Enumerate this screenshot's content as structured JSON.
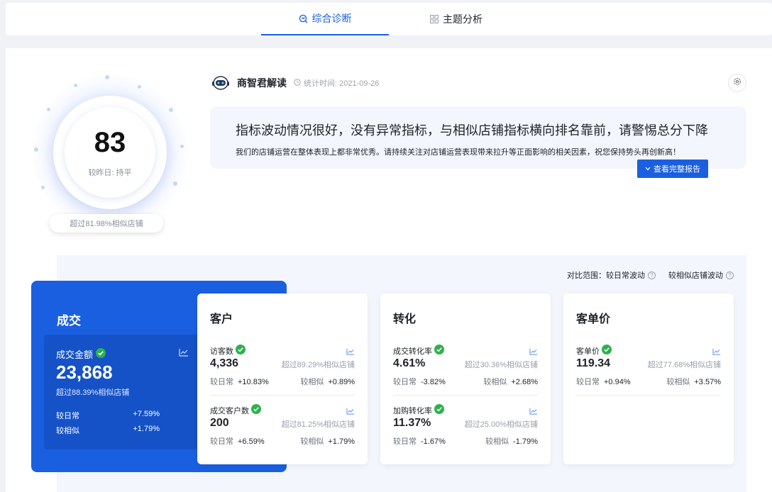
{
  "tabs": [
    {
      "label": "综合诊断",
      "active": true
    },
    {
      "label": "主题分析",
      "active": false
    }
  ],
  "score": {
    "value": "83",
    "compare": "较昨日: 持平",
    "exceed": "超过81.98%相似店铺",
    "value_number": 83
  },
  "insight": {
    "source": "商智君解读",
    "time": "统计时间: 2021-09-26",
    "headline": "指标波动情况很好，没有异常指标，与相似店铺指标横向排名靠前，请警惕总分下降",
    "detail": "我们的店铺运营在整体表现上都非常优秀。请持续关注对店铺运营表现带来拉升等正面影响的相关因素，祝您保持势头再创新高！",
    "report_button": "查看完整报告"
  },
  "compare_range": {
    "label1": "对比范围：较日常波动",
    "label2": "较相似店铺波动"
  },
  "deal": {
    "title": "成交",
    "metric_name": "成交金额",
    "value": "23,868",
    "exceed": "超过88.39%相似店铺",
    "rows": [
      {
        "label": "较日常",
        "value": "+7.59%"
      },
      {
        "label": "较相似",
        "value": "+1.79%"
      }
    ]
  },
  "cards": [
    {
      "title": "客户",
      "metrics": [
        {
          "name": "访客数",
          "value": "4,336",
          "exceed": "超过89.29%相似店铺",
          "daily_label": "较日常",
          "daily": "+10.83%",
          "similar_label": "较相似",
          "similar": "+0.89%"
        },
        {
          "name": "成交客户数",
          "value": "200",
          "exceed": "超过81.25%相似店铺",
          "daily_label": "较日常",
          "daily": "+6.59%",
          "similar_label": "较相似",
          "similar": "+1.79%"
        }
      ]
    },
    {
      "title": "转化",
      "metrics": [
        {
          "name": "成交转化率",
          "value": "4.61%",
          "exceed": "超过30.36%相似店铺",
          "daily_label": "较日常",
          "daily": "-3.82%",
          "similar_label": "较相似",
          "similar": "+2.68%"
        },
        {
          "name": "加购转化率",
          "value": "11.37%",
          "exceed": "超过25.00%相似店铺",
          "daily_label": "较日常",
          "daily": "-1.67%",
          "similar_label": "较相似",
          "similar": "-1.79%"
        }
      ]
    },
    {
      "title": "客单价",
      "metrics": [
        {
          "name": "客单价",
          "value": "119.34",
          "exceed": "超过77.68%相似店铺",
          "daily_label": "较日常",
          "daily": "+0.94%",
          "similar_label": "较相似",
          "similar": "+3.57%"
        }
      ]
    }
  ],
  "colors": {
    "accent": "#1a5fe0",
    "check": "#2bb24c"
  },
  "icons": {
    "tab1": "diagnosis-icon",
    "tab2": "grid-icon",
    "gear": "gear-icon",
    "chart": "trend-chart-icon",
    "check": "check-circle-icon"
  }
}
